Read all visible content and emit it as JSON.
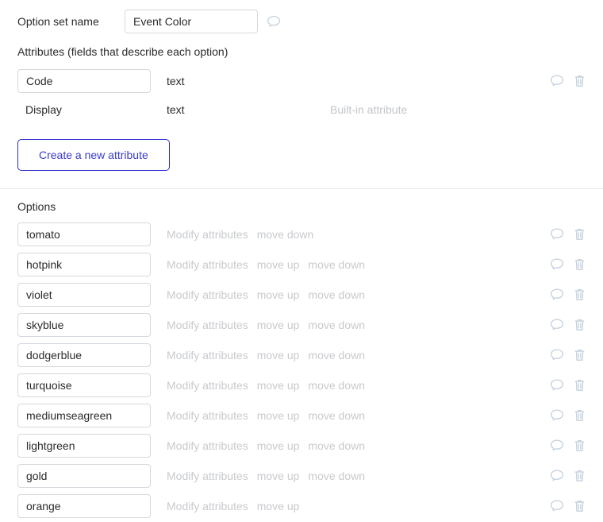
{
  "option_set": {
    "name_label": "Option set name",
    "name_value": "Event Color",
    "name_comment_icon": "comment-bubble-icon"
  },
  "attributes": {
    "heading": "Attributes (fields that describe each option)",
    "create_button_label": "Create a new attribute",
    "builtin_note": "Built-in attribute",
    "rows": [
      {
        "name": "Code",
        "type": "text",
        "editable": true,
        "builtin": "",
        "comment_icon": "comment-bubble-icon",
        "delete_icon": "trash-icon"
      },
      {
        "name": "Display",
        "type": "text",
        "editable": false,
        "builtin": "Built-in attribute",
        "comment_icon": "",
        "delete_icon": ""
      }
    ]
  },
  "options": {
    "heading": "Options",
    "modify_label": "Modify attributes",
    "move_up_label": "move up",
    "move_down_label": "move down",
    "comment_icon": "comment-bubble-icon",
    "delete_icon": "trash-icon",
    "rows": [
      {
        "value": "tomato",
        "move_up": false,
        "move_down": true
      },
      {
        "value": "hotpink",
        "move_up": true,
        "move_down": true
      },
      {
        "value": "violet",
        "move_up": true,
        "move_down": true
      },
      {
        "value": "skyblue",
        "move_up": true,
        "move_down": true
      },
      {
        "value": "dodgerblue",
        "move_up": true,
        "move_down": true
      },
      {
        "value": "turquoise",
        "move_up": true,
        "move_down": true
      },
      {
        "value": "mediumseagreen",
        "move_up": true,
        "move_down": true
      },
      {
        "value": "lightgreen",
        "move_up": true,
        "move_down": true
      },
      {
        "value": "gold",
        "move_up": true,
        "move_down": true
      },
      {
        "value": "orange",
        "move_up": true,
        "move_down": false
      }
    ]
  },
  "colors": {
    "text": "#2b2b2b",
    "muted": "#c8cacd",
    "icon": "#c3d0dd",
    "accent": "#3b3bc9",
    "border": "#d5d9dd",
    "divider": "#e6e8ea"
  }
}
